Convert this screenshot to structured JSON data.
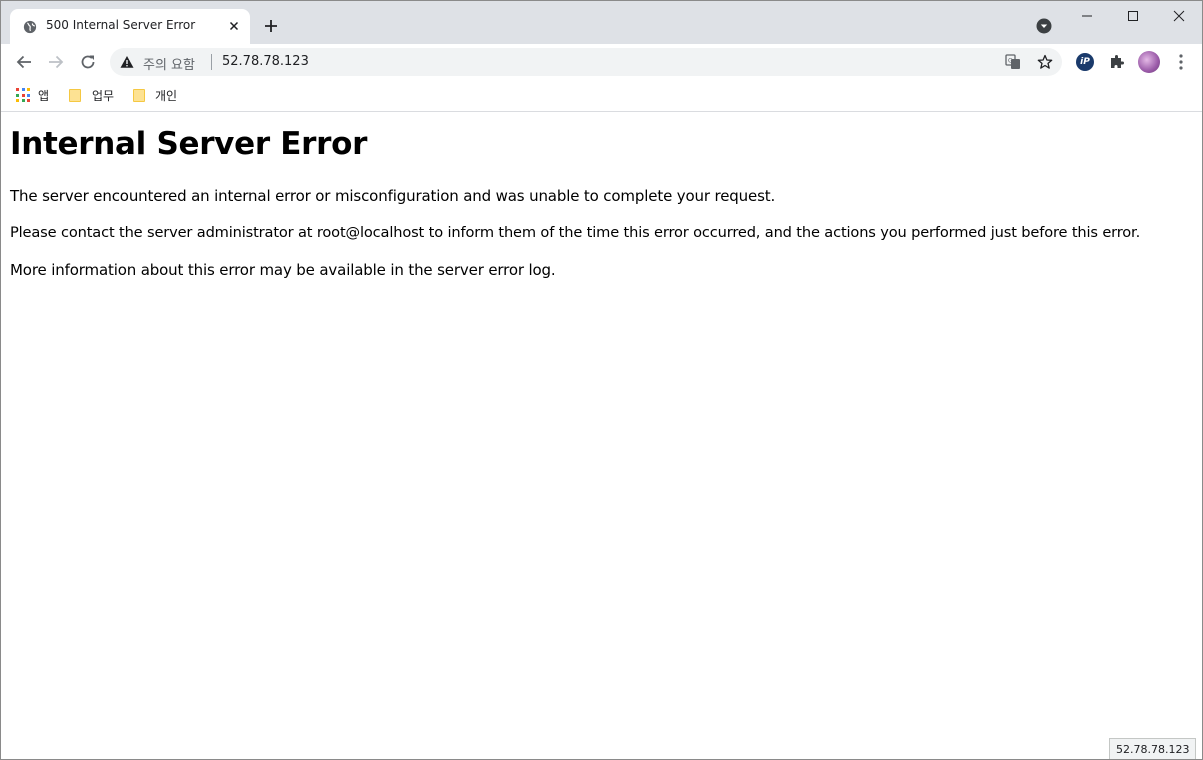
{
  "tab": {
    "title": "500 Internal Server Error"
  },
  "window_controls": {
    "minimize": "minimize",
    "maximize": "maximize",
    "close": "close"
  },
  "omnibox": {
    "security_label": "주의 요함",
    "url": "52.78.78.123"
  },
  "bookmarks": [
    {
      "label": "앱",
      "icon": "apps-grid-icon"
    },
    {
      "label": "업무",
      "icon": "folder-icon"
    },
    {
      "label": "개인",
      "icon": "folder-icon"
    }
  ],
  "page": {
    "heading": "Internal Server Error",
    "paragraphs": [
      "The server encountered an internal error or misconfiguration and was unable to complete your request.",
      "Please contact the server administrator at root@localhost to inform them of the time this error occurred, and the actions you performed just before this error.",
      "More information about this error may be available in the server error log."
    ]
  },
  "status_bar": {
    "text": "52.78.78.123"
  },
  "extensions": {
    "ip_badge": "iP"
  },
  "colors": {
    "tabstrip_bg": "#dee1e6",
    "omnibox_bg": "#f1f3f4",
    "icon_gray": "#5f6368"
  }
}
